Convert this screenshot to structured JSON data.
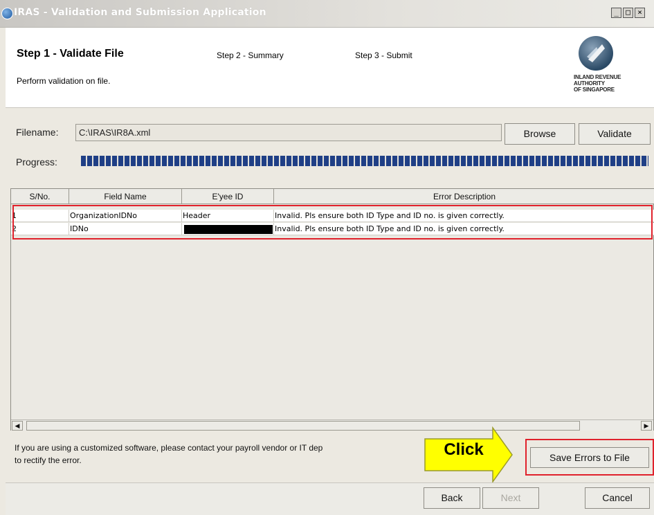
{
  "window": {
    "title": "IRAS - Validation and Submission Application",
    "controls": {
      "minimize": "_",
      "restore": "□",
      "close": "×"
    }
  },
  "header": {
    "step1": "Step 1 - Validate File",
    "step2": "Step 2 - Summary",
    "step3": "Step 3 - Submit",
    "description": "Perform validation on file.",
    "logo_text": "INLAND REVENUE\nAUTHORITY\nOF SINGAPORE"
  },
  "form": {
    "filename_label": "Filename:",
    "filename_value": "C:\\IRAS\\IR8A.xml",
    "browse_label": "Browse",
    "validate_label": "Validate",
    "progress_label": "Progress:",
    "progress_fraction": 1.0
  },
  "table": {
    "columns": [
      "S/No.",
      "Field Name",
      "E'yee ID",
      "Error Description"
    ],
    "rows": [
      {
        "sno": "1",
        "field": "OrganizationIDNo",
        "eyee_id": "Header",
        "error": "Invalid. Pls ensure both ID Type and ID no. is given correctly."
      },
      {
        "sno": "2",
        "field": "IDNo",
        "eyee_id": "",
        "error": "Invalid. Pls ensure both ID Type and ID no. is given correctly."
      }
    ]
  },
  "footer": {
    "message": "If you are using a customized software, please contact your payroll vendor or IT dep",
    "message_line2": "to rectify the error.",
    "click_label": "Click",
    "save_errors_label": "Save Errors to File"
  },
  "nav": {
    "back_label": "Back",
    "next_label": "Next",
    "cancel_label": "Cancel"
  },
  "colors": {
    "progress": "#1f3f86",
    "highlight": "#e0212b",
    "callout": "#ffff00"
  }
}
